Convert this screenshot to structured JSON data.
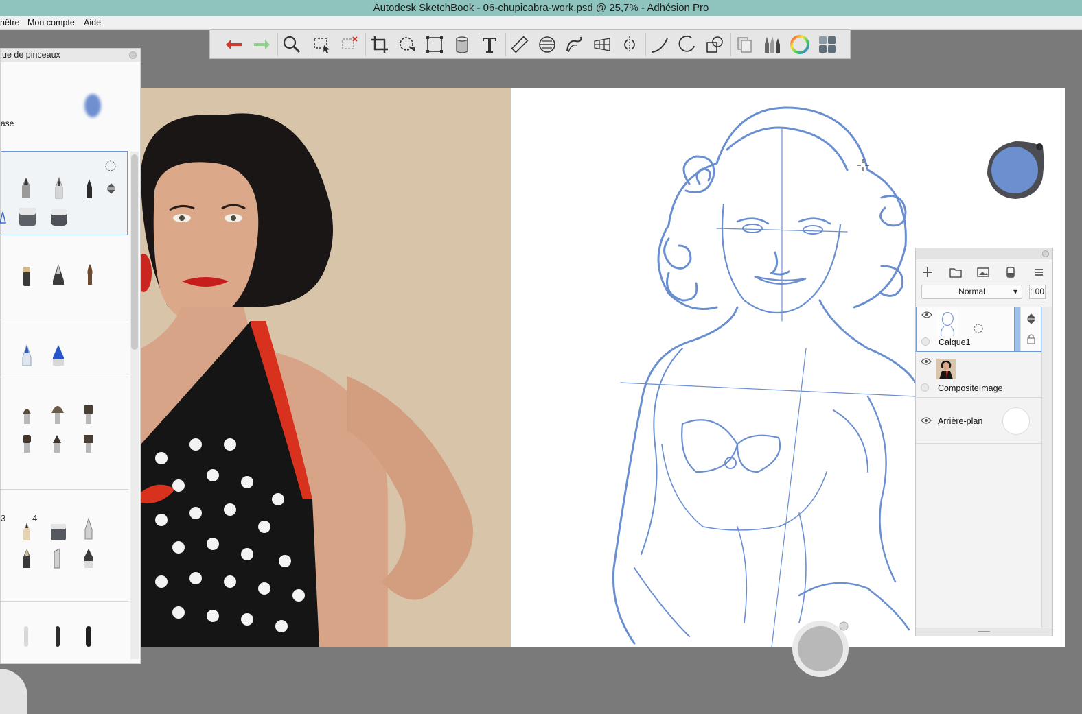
{
  "window": {
    "title": "Autodesk SketchBook - 06-chupicabra-work.psd @ 25,7% - Adhésion Pro"
  },
  "menu": {
    "items": [
      "nêtre",
      "Mon compte",
      "Aide"
    ]
  },
  "toolbar": {
    "tools": [
      "undo-icon",
      "redo-icon",
      "zoom-icon",
      "select-icon",
      "lasso-select-icon",
      "crop-icon",
      "transform-icon",
      "distort-icon",
      "fill-icon",
      "text-icon",
      "ruler-icon",
      "ellipse-guide-icon",
      "french-curve-icon",
      "perspective-icon",
      "symmetry-icon",
      "stroke-icon",
      "ellipse-icon",
      "shapes-icon",
      "copy-layer-icon",
      "brushes-icon",
      "color-wheel-icon",
      "ui-toggle-icon"
    ]
  },
  "brush_library": {
    "title": "ue de pinceaux",
    "preset_label": "ase",
    "numbers": [
      "3",
      "4"
    ],
    "preview_color": "#6f8fd0"
  },
  "layers": {
    "blend_mode": "Normal",
    "opacity": "100",
    "items": [
      {
        "name": "Calque1",
        "selected": true
      },
      {
        "name": "CompositeImage",
        "selected": false
      },
      {
        "name": "Arrière-plan",
        "selected": false
      }
    ]
  },
  "colors": {
    "sketch_stroke": "#6a8fd0",
    "color_puck": "#6c8fcf",
    "titlebar": "#8ec4bd"
  }
}
